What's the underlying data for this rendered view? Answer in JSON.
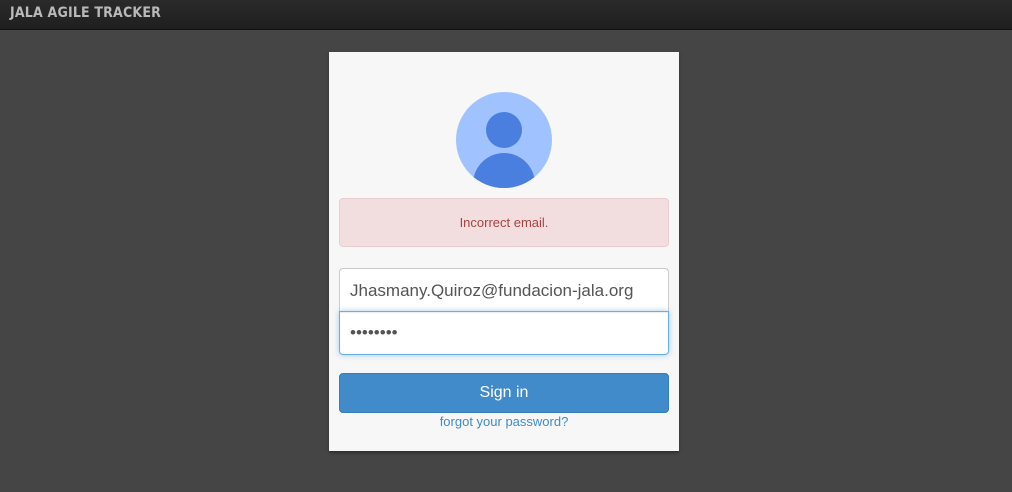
{
  "app": {
    "title": "JALA AGILE TRACKER"
  },
  "login": {
    "error_message": "Incorrect email.",
    "email_value": "Jhasmany.Quiroz@fundacion-jala.org",
    "password_value": "jala1234",
    "sign_in_label": "Sign in",
    "forgot_label": "forgot your password?"
  },
  "icons": {
    "avatar": "user-avatar-icon"
  },
  "colors": {
    "accent": "#428bca",
    "error_bg": "#f2dede",
    "error_text": "#a94442",
    "avatar_bg": "#a0c3ff",
    "avatar_fg": "#4a7fe0"
  }
}
